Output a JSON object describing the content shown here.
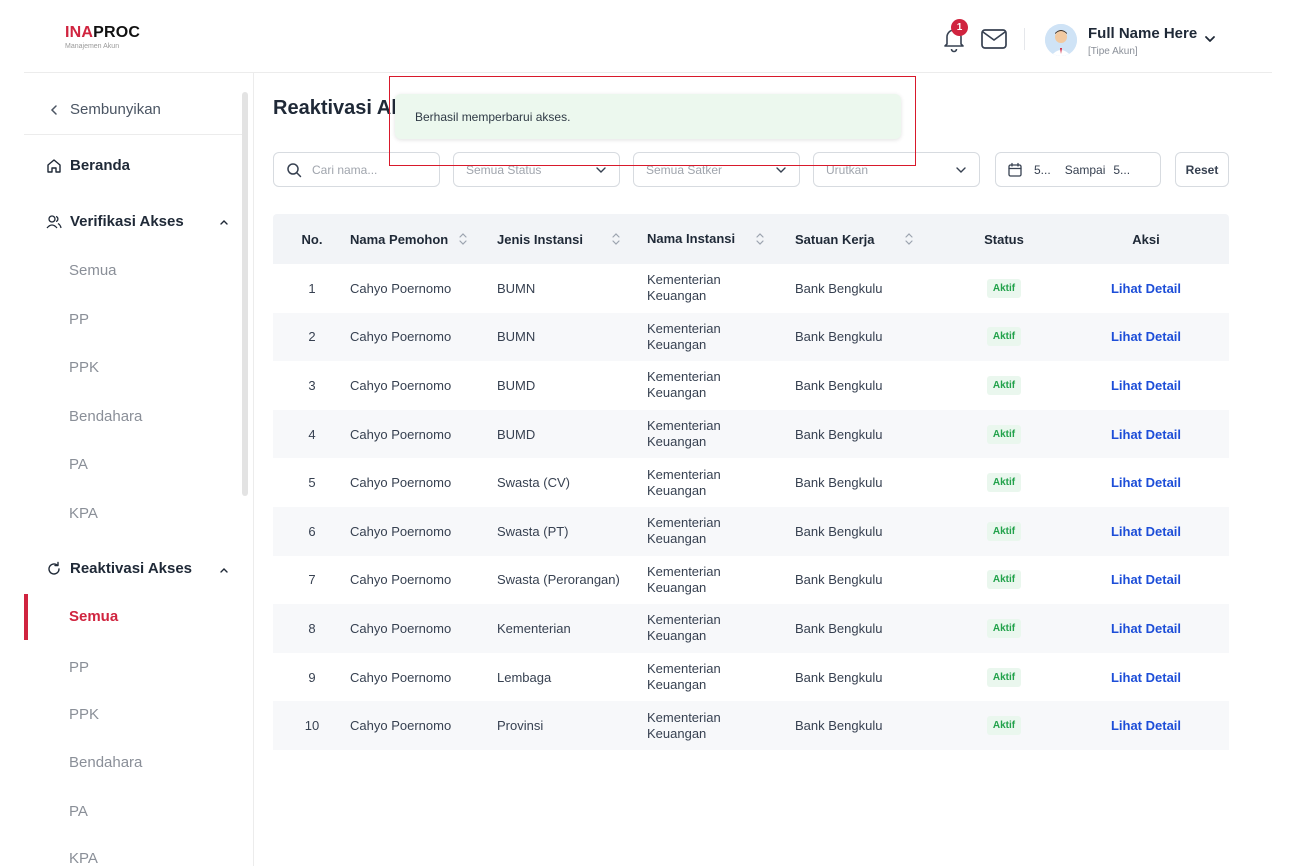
{
  "header": {
    "logo_main_red": "INA",
    "logo_main_dark": "PROC",
    "logo_sub": "Manajemen Akun",
    "notification_count": "1",
    "user_name": "Full Name Here",
    "user_type": "[Tipe Akun]"
  },
  "sidebar": {
    "hide_label": "Sembunyikan",
    "home_label": "Beranda",
    "verifikasi": {
      "label": "Verifikasi Akses",
      "items": [
        "Semua",
        "PP",
        "PPK",
        "Bendahara",
        "PA",
        "KPA"
      ]
    },
    "reaktivasi": {
      "label": "Reaktivasi Akses",
      "items": [
        "Semua",
        "PP",
        "PPK",
        "Bendahara",
        "PA",
        "KPA"
      ],
      "active_item": "Semua"
    }
  },
  "main": {
    "title": "Reaktivasi Akses",
    "toast": "Berhasil memperbarui akses.",
    "filters": {
      "search_placeholder": "Cari nama...",
      "status": "Semua Status",
      "satker": "Semua Satker",
      "sort": "Urutkan",
      "date_from": "5...",
      "date_sep": "Sampai",
      "date_to": "5...",
      "reset_label": "Reset"
    },
    "table": {
      "columns": [
        "No.",
        "Nama Pemohon",
        "Jenis Instansi",
        "Nama Instansi",
        "Satuan Kerja",
        "Status",
        "Aksi"
      ],
      "rows": [
        {
          "no": "1",
          "nama": "Cahyo Poernomo",
          "jenis": "BUMN",
          "instansi_1": "Kementerian",
          "instansi_2": "Keuangan",
          "satuan": "Bank Bengkulu",
          "status": "Aktif",
          "aksi": "Lihat Detail"
        },
        {
          "no": "2",
          "nama": "Cahyo Poernomo",
          "jenis": "BUMN",
          "instansi_1": "Kementerian",
          "instansi_2": "Keuangan",
          "satuan": "Bank Bengkulu",
          "status": "Aktif",
          "aksi": "Lihat Detail"
        },
        {
          "no": "3",
          "nama": "Cahyo Poernomo",
          "jenis": "BUMD",
          "instansi_1": "Kementerian",
          "instansi_2": "Keuangan",
          "satuan": "Bank Bengkulu",
          "status": "Aktif",
          "aksi": "Lihat Detail"
        },
        {
          "no": "4",
          "nama": "Cahyo Poernomo",
          "jenis": "BUMD",
          "instansi_1": "Kementerian",
          "instansi_2": "Keuangan",
          "satuan": "Bank Bengkulu",
          "status": "Aktif",
          "aksi": "Lihat Detail"
        },
        {
          "no": "5",
          "nama": "Cahyo Poernomo",
          "jenis": "Swasta (CV)",
          "instansi_1": "Kementerian",
          "instansi_2": "Keuangan",
          "satuan": "Bank Bengkulu",
          "status": "Aktif",
          "aksi": "Lihat Detail"
        },
        {
          "no": "6",
          "nama": "Cahyo Poernomo",
          "jenis": "Swasta (PT)",
          "instansi_1": "Kementerian",
          "instansi_2": "Keuangan",
          "satuan": "Bank Bengkulu",
          "status": "Aktif",
          "aksi": "Lihat Detail"
        },
        {
          "no": "7",
          "nama": "Cahyo Poernomo",
          "jenis": "Swasta (Perorangan)",
          "instansi_1": "Kementerian",
          "instansi_2": "Keuangan",
          "satuan": "Bank Bengkulu",
          "status": "Aktif",
          "aksi": "Lihat Detail"
        },
        {
          "no": "8",
          "nama": "Cahyo Poernomo",
          "jenis": "Kementerian",
          "instansi_1": "Kementerian",
          "instansi_2": "Keuangan",
          "satuan": "Bank Bengkulu",
          "status": "Aktif",
          "aksi": "Lihat Detail"
        },
        {
          "no": "9",
          "nama": "Cahyo Poernomo",
          "jenis": "Lembaga",
          "instansi_1": "Kementerian",
          "instansi_2": "Keuangan",
          "satuan": "Bank Bengkulu",
          "status": "Aktif",
          "aksi": "Lihat Detail"
        },
        {
          "no": "10",
          "nama": "Cahyo Poernomo",
          "jenis": "Provinsi",
          "instansi_1": "Kementerian",
          "instansi_2": "Keuangan",
          "satuan": "Bank Bengkulu",
          "status": "Aktif",
          "aksi": "Lihat Detail"
        }
      ]
    }
  },
  "colors": {
    "brand_red": "#d0243f",
    "link_blue": "#1d4ed8",
    "status_green": "#22a24b",
    "toast_bg": "#ecf8ee"
  },
  "icons": [
    "bell-icon",
    "mail-icon",
    "chevron-down-icon",
    "chevron-left-icon",
    "home-icon",
    "users-icon",
    "refresh-icon",
    "chevron-up-icon",
    "search-icon",
    "calendar-icon",
    "sort-icon"
  ]
}
